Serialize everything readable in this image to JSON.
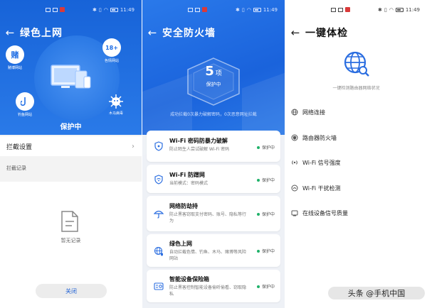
{
  "status_bar": {
    "time": "11:49"
  },
  "panel1": {
    "title": "绿色上网",
    "badges": [
      {
        "icon_text": "赌",
        "label": "赌博网站"
      },
      {
        "icon_text": "18+",
        "label": "色情网站"
      },
      {
        "icon_text": "",
        "label": "钓鱼网站"
      },
      {
        "icon_text": "",
        "label": "木马病毒"
      }
    ],
    "protect_status": "保护中",
    "intercept_settings": "拦截设置",
    "intercept_records": "拦截记录",
    "empty_text": "暂无记录",
    "close_button": "关闭"
  },
  "panel2": {
    "title": "安全防火墙",
    "count": "5",
    "count_unit": "项",
    "count_status": "保护中",
    "summary": "成功拦截0次暴力破解密码，0次恶意网址拦截",
    "cards": [
      {
        "title": "Wi-Fi 密码防暴力破解",
        "desc": "防止陌生人尝试破解 Wi-Fi 密码",
        "status": "保护中",
        "icon": "lock-shield-icon"
      },
      {
        "title": "Wi-Fi 防蹭网",
        "desc": "当前模式：密码模式",
        "status": "保护中",
        "icon": "wifi-shield-icon"
      },
      {
        "title": "网络防劫持",
        "desc": "防止黑客窃取支付密码、账号、隐私等行为",
        "status": "保护中",
        "icon": "umbrella-icon"
      },
      {
        "title": "绿色上网",
        "desc": "自动拦截色情、钓鱼、木马、赌博等风险网站",
        "status": "保护中",
        "icon": "globe-shield-icon"
      },
      {
        "title": "智能设备保险箱",
        "desc": "防止黑客控制智能设备偷听偷看、窃取隐私",
        "status": "保护中",
        "icon": "device-safe-icon"
      }
    ]
  },
  "panel3": {
    "title": "一键体检",
    "subtitle": "一键检测路由器网络状况",
    "items": [
      {
        "label": "网络连接",
        "icon": "globe-small-icon"
      },
      {
        "label": "路由器防火墙",
        "icon": "firewall-icon"
      },
      {
        "label": "Wi-Fi 信号强度",
        "icon": "signal-icon"
      },
      {
        "label": "Wi-Fi 干扰检测",
        "icon": "interference-icon"
      },
      {
        "label": "在线设备信号质量",
        "icon": "device-quality-icon"
      }
    ],
    "watermark": "头条 @手机中国"
  }
}
